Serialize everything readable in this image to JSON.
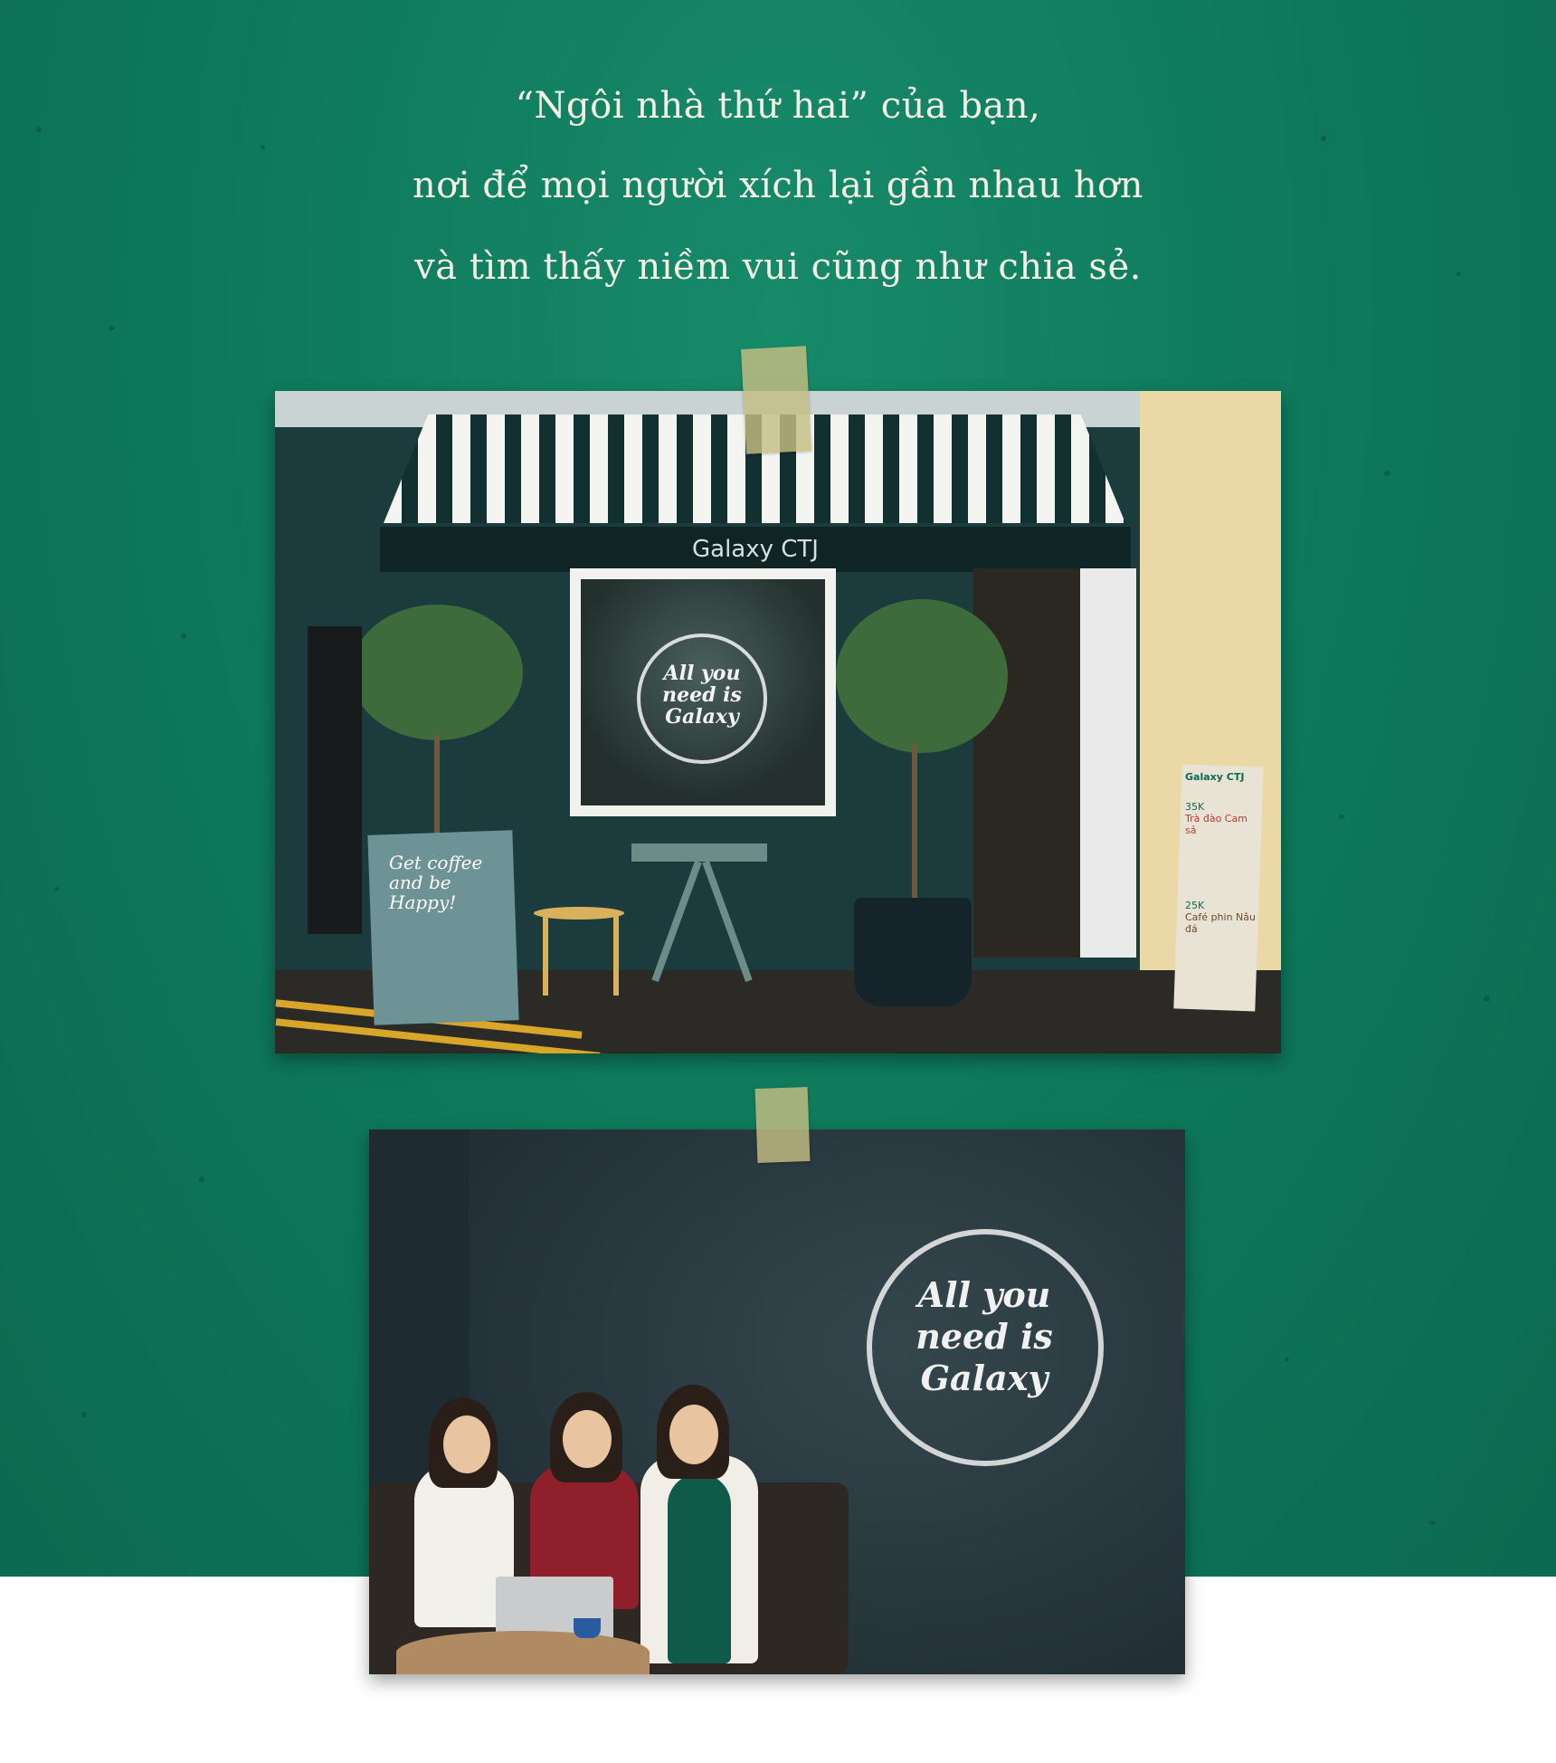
{
  "quote": {
    "line1": "“Ngôi nhà thứ hai” của bạn,",
    "line2": "nơi để mọi người xích lại gần nhau hơn",
    "line3": "và tìm thấy niềm vui cũng như chia sẻ."
  },
  "storefront": {
    "awning_brand": "Galaxy CTJ",
    "window_logo": "All you need is Galaxy",
    "left_sign": "Get coffee and be Happy!",
    "right_sign_brand": "Galaxy CTJ",
    "right_sign_item1": "Trà đào Cam sả",
    "right_sign_price1": "35K",
    "right_sign_item2": "Café phin Nâu đá",
    "right_sign_price2": "25K"
  },
  "interior": {
    "wall_logo": "All you need is Galaxy"
  },
  "colors": {
    "background_green": "#0f7a5c",
    "quote_text": "#f3efe2",
    "tape": "#c4be82"
  }
}
